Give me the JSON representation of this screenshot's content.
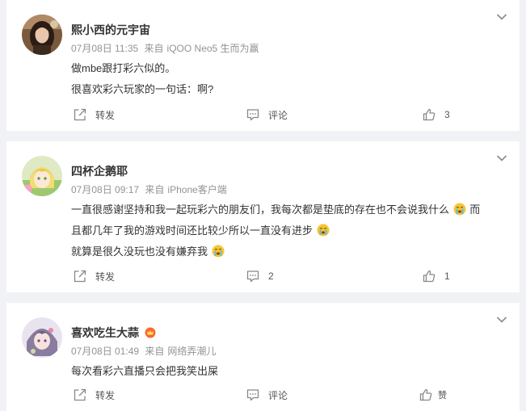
{
  "comments": [
    {
      "username": "熙小西的元宇宙",
      "date": "07月08日 11:35",
      "source_prefix": "来自",
      "source": "iQOO Neo5 生而为赢",
      "lines": [
        "做mbe跟打彩六似的。",
        "很喜欢彩六玩家的一句话：啊?"
      ],
      "forward_label": "转发",
      "comment_label": "评论",
      "like_label": "3"
    },
    {
      "username": "四杯企鹅耶",
      "date": "07月08日 09:17",
      "source_prefix": "来自",
      "source": "iPhone客户端",
      "line1": "一直很感谢坚持和我一起玩彩六的朋友们，我每次都是垫底的存在也不会说我什么",
      "line1_tail": "而",
      "line2": "且都几年了我的游戏时间还比较少所以一直没有进步",
      "line3": "就算是很久没玩也没有嫌弃我",
      "forward_label": "转发",
      "comment_label": "2",
      "like_label": "1"
    },
    {
      "username": "喜欢吃生大蒜",
      "date": "07月08日 01:49",
      "source_prefix": "来自",
      "source": "网络弄潮儿",
      "lines": [
        "每次看彩六直播只会把我笑出屎"
      ],
      "forward_label": "转发",
      "comment_label": "评论",
      "like_label": "赞"
    }
  ],
  "icons": {
    "forward": "forward-icon",
    "comment": "comment-icon",
    "like": "thumbs-up-icon",
    "menu": "chevron-down-icon",
    "emoji": "crying-emoji-icon",
    "badge": "crown-badge-icon"
  }
}
